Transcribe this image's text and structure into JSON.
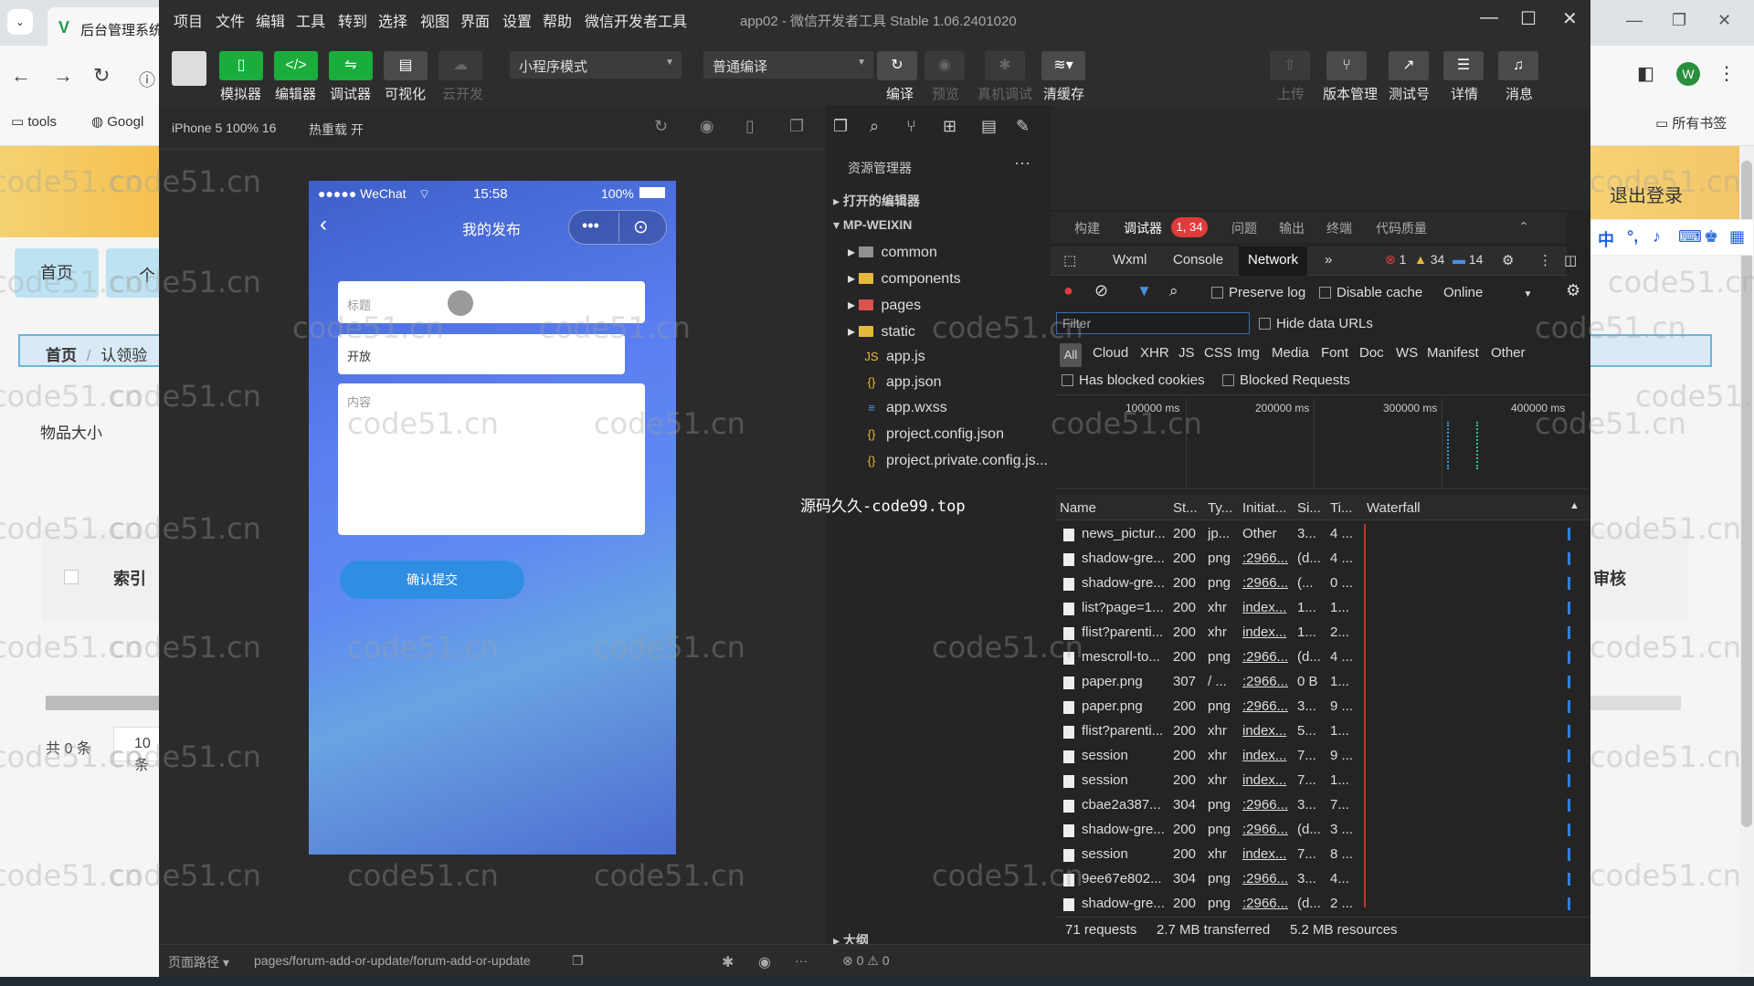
{
  "browser": {
    "tab_title": "后台管理系统",
    "bookmarks": [
      "tools",
      "Googl",
      "所有书签"
    ],
    "avatar_letter": "W"
  },
  "website": {
    "logout": "退出登录",
    "nav_home": "首页",
    "nav_second": "个",
    "breadcrumb_home": "首页",
    "breadcrumb_sep": "/",
    "breadcrumb_current": "认领验",
    "field_item_size": "物品大小",
    "table_index": "索引",
    "table_audit": "审核",
    "total": "共 0 条",
    "page_size": "10条"
  },
  "devtools": {
    "menu": [
      "项目",
      "文件",
      "编辑",
      "工具",
      "转到",
      "选择",
      "视图",
      "界面",
      "设置",
      "帮助",
      "微信开发者工具"
    ],
    "title": "app02 - 微信开发者工具 Stable 1.06.2401020",
    "toolbar": {
      "simulator": "模拟器",
      "editor": "编辑器",
      "debugger": "调试器",
      "visual": "可视化",
      "cloud": "云开发",
      "mode": "小程序模式",
      "compile_mode": "普通编译",
      "compile": "编译",
      "preview": "预览",
      "remote_debug": "真机调试",
      "clear_cache": "清缓存",
      "upload": "上传",
      "version": "版本管理",
      "test": "测试号",
      "details": "详情",
      "messages": "消息"
    },
    "sim_bar": {
      "device": "iPhone 5 100% 16",
      "hot_reload": "热重载 开"
    },
    "phone": {
      "carrier": "●●●●● WeChat",
      "time": "15:58",
      "battery": "100%",
      "page_title": "我的发布",
      "field_title": "标题",
      "field_open": "开放",
      "field_content": "内容",
      "submit": "确认提交"
    },
    "bottom": {
      "path_label": "页面路径",
      "path": "pages/forum-add-or-update/forum-add-or-update",
      "status": "⊗ 0 ⚠ 0"
    },
    "explorer": {
      "title": "资源管理器",
      "open_editors": "打开的编辑器",
      "project": "MP-WEIXIN",
      "folders": [
        "common",
        "components",
        "pages",
        "static"
      ],
      "files": [
        "app.js",
        "app.json",
        "app.wxss",
        "project.config.json",
        "project.private.config.js..."
      ],
      "outline": "大纲"
    },
    "panel_tabs": [
      "构建",
      "调试器",
      "问题",
      "输出",
      "终端",
      "代码质量"
    ],
    "panel_badge": "1, 34",
    "sub_tabs": [
      "Wxml",
      "Console",
      "Network"
    ],
    "counts": {
      "errors": "1",
      "warnings": "34",
      "info": "14"
    },
    "network": {
      "preserve_log": "Preserve log",
      "disable_cache": "Disable cache",
      "throttle": "Online",
      "filter_placeholder": "Filter",
      "hide_data_urls": "Hide data URLs",
      "types": [
        "Cloud",
        "XHR",
        "JS",
        "CSS",
        "Img",
        "Media",
        "Font",
        "Doc",
        "WS",
        "Manifest",
        "Other"
      ],
      "type_all": "All",
      "has_blocked_cookies": "Has blocked cookies",
      "blocked_requests": "Blocked Requests",
      "timeline_labels": [
        "100000 ms",
        "200000 ms",
        "300000 ms",
        "400000 ms"
      ],
      "columns": [
        "Name",
        "St...",
        "Ty...",
        "Initiat...",
        "Si...",
        "Ti...",
        "Waterfall"
      ],
      "rows": [
        [
          "news_pictur...",
          "200",
          "jp...",
          "Other",
          "3...",
          "4 ..."
        ],
        [
          "shadow-gre...",
          "200",
          "png",
          ":2966...",
          "(d...",
          "4 ..."
        ],
        [
          "shadow-gre...",
          "200",
          "png",
          ":2966...",
          "(...",
          "0 ..."
        ],
        [
          "list?page=1...",
          "200",
          "xhr",
          "index...",
          "1...",
          "1..."
        ],
        [
          "flist?parenti...",
          "200",
          "xhr",
          "index...",
          "1...",
          "2..."
        ],
        [
          "mescroll-to...",
          "200",
          "png",
          ":2966...",
          "(d...",
          "4 ..."
        ],
        [
          "paper.png",
          "307",
          "/ ...",
          ":2966...",
          "0 B",
          "1..."
        ],
        [
          "paper.png",
          "200",
          "png",
          ":2966...",
          "3...",
          "9 ..."
        ],
        [
          "flist?parenti...",
          "200",
          "xhr",
          "index...",
          "5...",
          "1..."
        ],
        [
          "session",
          "200",
          "xhr",
          "index...",
          "7...",
          "9 ..."
        ],
        [
          "session",
          "200",
          "xhr",
          "index...",
          "7...",
          "1..."
        ],
        [
          "cbae2a387...",
          "304",
          "png",
          ":2966...",
          "3...",
          "7..."
        ],
        [
          "shadow-gre...",
          "200",
          "png",
          ":2966...",
          "(d...",
          "3 ..."
        ],
        [
          "session",
          "200",
          "xhr",
          "index...",
          "7...",
          "8 ..."
        ],
        [
          "9ee67e802...",
          "304",
          "png",
          ":2966...",
          "3...",
          "4..."
        ],
        [
          "shadow-gre...",
          "200",
          "png",
          ":2966...",
          "(d...",
          "2 ..."
        ]
      ],
      "footer": [
        "71 requests",
        "2.7 MB transferred",
        "5.2 MB resources"
      ]
    }
  },
  "overlay": "源码久久-code99.top",
  "watermark": "code51.cn",
  "colors": {
    "accent_green": "#1aad3b",
    "error_red": "#e03c3c",
    "link_blue": "#2f8ee2"
  }
}
